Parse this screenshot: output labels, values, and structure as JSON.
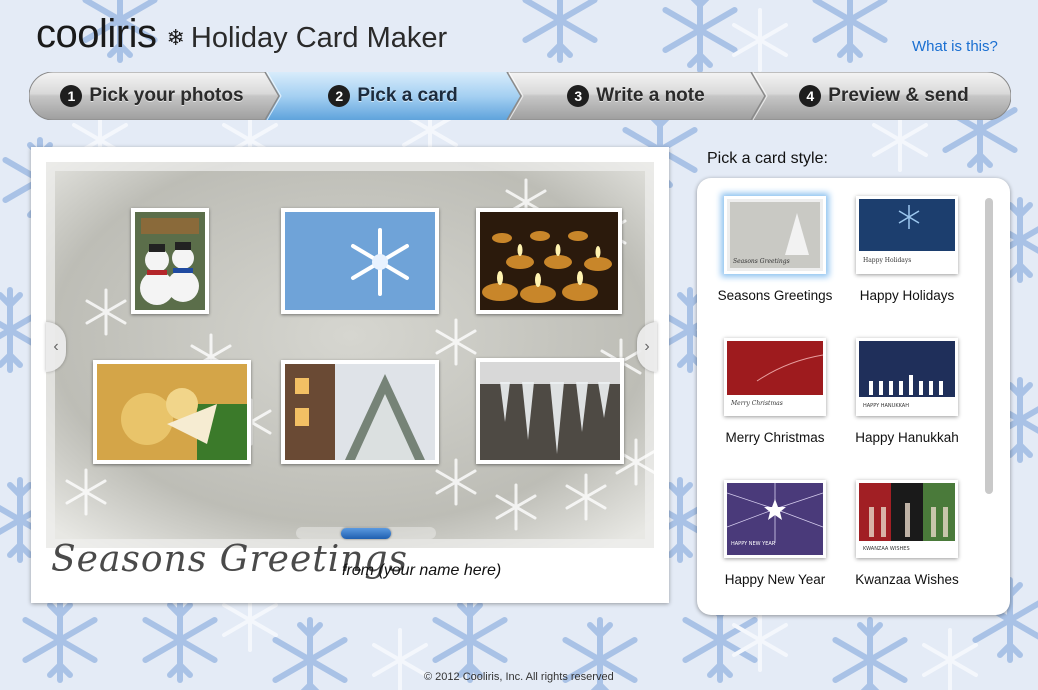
{
  "header": {
    "brand": "cooliris",
    "brand_icon": "snowflake-icon",
    "title": "Holiday Card Maker",
    "help_link": "What is this?"
  },
  "steps": [
    {
      "num": "1",
      "label": "Pick your photos",
      "active": false
    },
    {
      "num": "2",
      "label": "Pick a card",
      "active": true
    },
    {
      "num": "3",
      "label": "Write a note",
      "active": false
    },
    {
      "num": "4",
      "label": "Preview & send",
      "active": false
    }
  ],
  "card": {
    "greeting": "Seasons Greetings",
    "from": "from (your name here)",
    "photos": [
      "snowmen",
      "snowflake",
      "candles",
      "golden ornaments",
      "snowy house",
      "icicles"
    ],
    "nav_prev_icon": "chevron-left-icon",
    "nav_next_icon": "chevron-right-icon"
  },
  "picker": {
    "label": "Pick a card style:",
    "styles": [
      {
        "name": "Seasons Greetings",
        "caption": "Seasons Greetings",
        "selected": true
      },
      {
        "name": "Happy Holidays",
        "caption": "Happy Holidays",
        "selected": false
      },
      {
        "name": "Merry Christmas",
        "caption": "Merry Christmas",
        "selected": false
      },
      {
        "name": "Happy Hanukkah",
        "caption": "HAPPY HANUKKAH",
        "selected": false
      },
      {
        "name": "Happy New Year",
        "caption": "HAPPY NEW YEAR",
        "selected": false
      },
      {
        "name": "Kwanzaa Wishes",
        "caption": "KWANZAA WISHES",
        "selected": false
      }
    ]
  },
  "footer": "© 2012 Cooliris, Inc. All rights reserved",
  "colors": {
    "accent": "#1a6fd1",
    "active_step": "#8cc1ee",
    "selected_glow": "#8fc3f0"
  }
}
